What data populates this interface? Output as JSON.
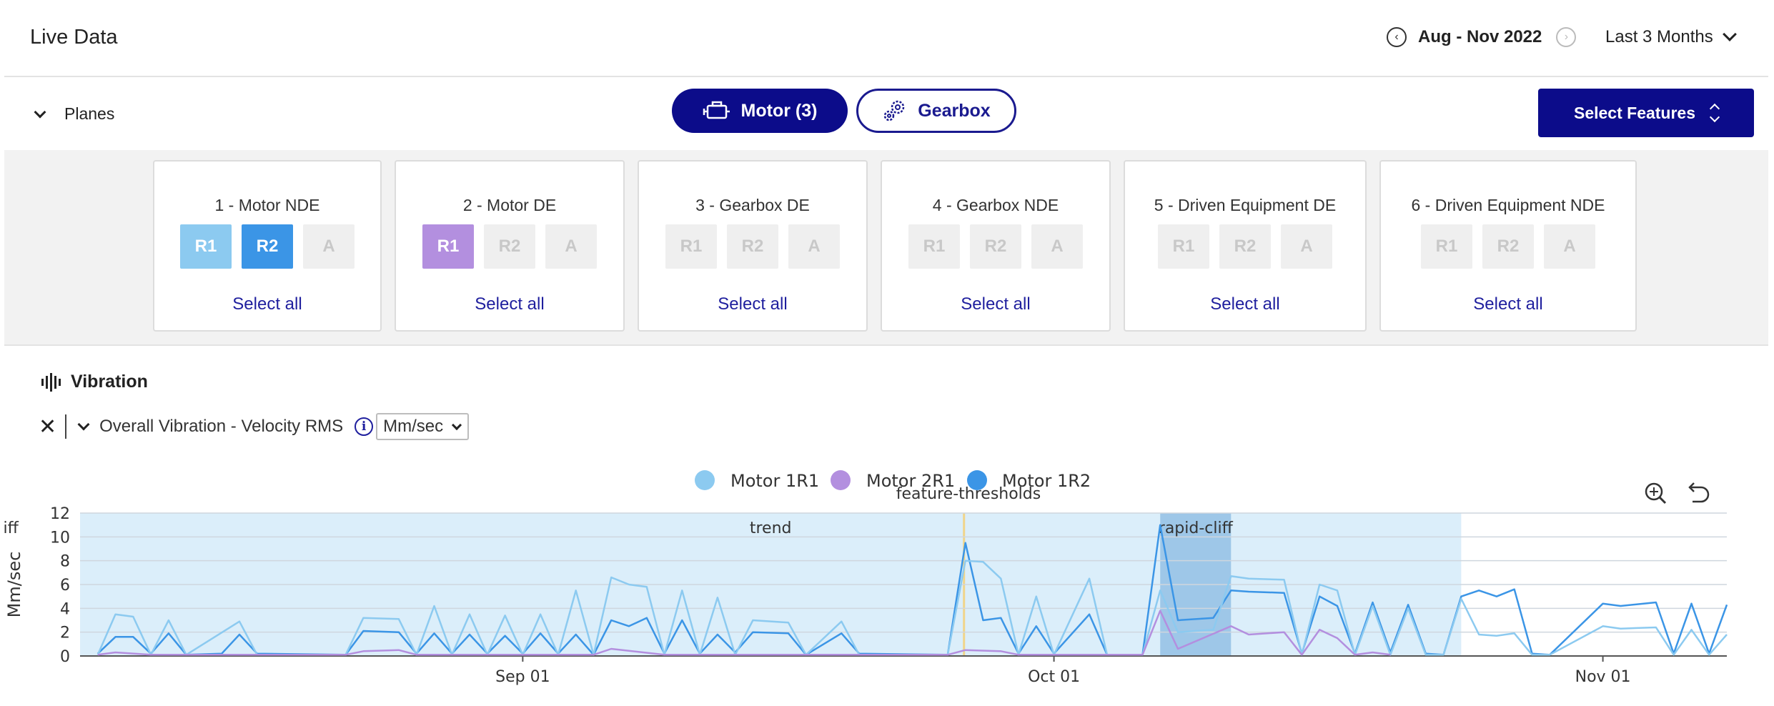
{
  "header": {
    "title": "Live Data",
    "date_range": "Aug - Nov 2022",
    "period": "Last 3 Months",
    "prev_icon": "chevron-left-circle-icon",
    "next_icon": "chevron-right-circle-icon"
  },
  "planes_bar": {
    "toggle_label": "Planes",
    "tabs": [
      {
        "label": "Motor (3)",
        "icon": "motor-icon",
        "active": true
      },
      {
        "label": "Gearbox",
        "icon": "gears-icon",
        "active": false
      }
    ],
    "select_features_label": "Select Features"
  },
  "planes": [
    {
      "name": "1 - Motor NDE",
      "chips": [
        {
          "label": "R1",
          "state": "sel-lightblue"
        },
        {
          "label": "R2",
          "state": "sel-blue"
        },
        {
          "label": "A",
          "state": "off"
        }
      ],
      "select_all": "Select all"
    },
    {
      "name": "2 - Motor DE",
      "chips": [
        {
          "label": "R1",
          "state": "sel-purple"
        },
        {
          "label": "R2",
          "state": "off"
        },
        {
          "label": "A",
          "state": "off"
        }
      ],
      "select_all": "Select all"
    },
    {
      "name": "3 - Gearbox DE",
      "chips": [
        {
          "label": "R1",
          "state": "off"
        },
        {
          "label": "R2",
          "state": "off"
        },
        {
          "label": "A",
          "state": "off"
        }
      ],
      "select_all": "Select all"
    },
    {
      "name": "4 - Gearbox NDE",
      "chips": [
        {
          "label": "R1",
          "state": "off"
        },
        {
          "label": "R2",
          "state": "off"
        },
        {
          "label": "A",
          "state": "off"
        }
      ],
      "select_all": "Select all"
    },
    {
      "name": "5 - Driven Equipment DE",
      "chips": [
        {
          "label": "R1",
          "state": "off"
        },
        {
          "label": "R2",
          "state": "off"
        },
        {
          "label": "A",
          "state": "off"
        }
      ],
      "select_all": "Select all"
    },
    {
      "name": "6 - Driven Equipment NDE",
      "chips": [
        {
          "label": "R1",
          "state": "off"
        },
        {
          "label": "R2",
          "state": "off"
        },
        {
          "label": "A",
          "state": "off"
        }
      ],
      "select_all": "Select all"
    }
  ],
  "vibration": {
    "section_title": "Vibration",
    "metric_label": "Overall Vibration - Velocity RMS",
    "unit": "Mm/sec"
  },
  "chart_data": {
    "type": "line",
    "ylabel": "Mm/sec",
    "ylim": [
      0,
      12
    ],
    "yticks": [
      0,
      2,
      4,
      6,
      8,
      10,
      12
    ],
    "x_range": [
      "2022-08-07",
      "2022-11-08"
    ],
    "xticks": [
      {
        "date": "2022-09-01",
        "label": "Sep 01"
      },
      {
        "date": "2022-10-01",
        "label": "Oct 01"
      },
      {
        "date": "2022-11-01",
        "label": "Nov 01"
      }
    ],
    "grid": true,
    "legend_position": "top-center",
    "legend": [
      {
        "name": "Motor 1R1",
        "color": "#8ccaf0"
      },
      {
        "name": "Motor 2R1",
        "color": "#b38fdf"
      },
      {
        "name": "Motor 1R2",
        "color": "#3b95e6"
      }
    ],
    "threshold_label": "feature-thresholds",
    "highlight_band": {
      "from": "2022-08-07",
      "to": "2022-10-24",
      "color": "#dbeefa"
    },
    "annotations": [
      {
        "label": "cliff",
        "from": "2022-08-37",
        "to": "2022-09-07"
      },
      {
        "label": "trend",
        "at": "2022-09-15"
      },
      {
        "label": "rapid-cliff",
        "from": "2022-10-07",
        "to": "2022-10-11"
      }
    ],
    "series": [
      {
        "name": "Motor 1R2",
        "color": "#3b95e6",
        "points": [
          [
            "2022-08-08",
            0.2
          ],
          [
            "2022-08-09",
            1.6
          ],
          [
            "2022-08-10",
            1.6
          ],
          [
            "2022-08-11",
            0.2
          ],
          [
            "2022-08-12",
            1.9
          ],
          [
            "2022-08-13",
            0.1
          ],
          [
            "2022-08-15",
            0.2
          ],
          [
            "2022-08-16",
            1.8
          ],
          [
            "2022-08-17",
            0.2
          ],
          [
            "2022-08-22",
            0.1
          ],
          [
            "2022-08-23",
            2.1
          ],
          [
            "2022-08-25",
            2.0
          ],
          [
            "2022-08-26",
            0.2
          ],
          [
            "2022-08-27",
            1.9
          ],
          [
            "2022-08-28",
            0.2
          ],
          [
            "2022-08-29",
            1.8
          ],
          [
            "2022-08-30",
            0.2
          ],
          [
            "2022-08-31",
            1.7
          ],
          [
            "2022-09-01",
            0.2
          ],
          [
            "2022-09-02",
            1.9
          ],
          [
            "2022-09-03",
            0.2
          ],
          [
            "2022-09-04",
            1.8
          ],
          [
            "2022-09-05",
            0.1
          ],
          [
            "2022-09-06",
            3.0
          ],
          [
            "2022-09-07",
            2.5
          ],
          [
            "2022-09-08",
            3.2
          ],
          [
            "2022-09-09",
            0.2
          ],
          [
            "2022-09-10",
            3.0
          ],
          [
            "2022-09-11",
            0.2
          ],
          [
            "2022-09-12",
            1.8
          ],
          [
            "2022-09-13",
            0.3
          ],
          [
            "2022-09-14",
            2.0
          ],
          [
            "2022-09-16",
            1.9
          ],
          [
            "2022-09-17",
            0.1
          ],
          [
            "2022-09-19",
            1.9
          ],
          [
            "2022-09-20",
            0.2
          ],
          [
            "2022-09-25",
            0.1
          ],
          [
            "2022-09-26",
            9.5
          ],
          [
            "2022-09-27",
            3.0
          ],
          [
            "2022-09-28",
            3.2
          ],
          [
            "2022-09-29",
            0.2
          ],
          [
            "2022-09-30",
            2.5
          ],
          [
            "2022-10-01",
            0.2
          ],
          [
            "2022-10-03",
            3.5
          ],
          [
            "2022-10-04",
            0.1
          ],
          [
            "2022-10-06",
            0.1
          ],
          [
            "2022-10-07",
            11.0
          ],
          [
            "2022-10-08",
            3.0
          ],
          [
            "2022-10-10",
            3.2
          ],
          [
            "2022-10-11",
            5.5
          ],
          [
            "2022-10-12",
            5.4
          ],
          [
            "2022-10-14",
            5.3
          ],
          [
            "2022-10-15",
            0.2
          ],
          [
            "2022-10-16",
            5.0
          ],
          [
            "2022-10-17",
            4.2
          ],
          [
            "2022-10-18",
            0.2
          ],
          [
            "2022-10-19",
            4.5
          ],
          [
            "2022-10-20",
            0.3
          ],
          [
            "2022-10-21",
            4.3
          ],
          [
            "2022-10-22",
            0.2
          ],
          [
            "2022-10-23",
            0.1
          ],
          [
            "2022-10-24",
            5.0
          ],
          [
            "2022-10-25",
            5.5
          ],
          [
            "2022-10-26",
            5.0
          ],
          [
            "2022-10-27",
            5.6
          ],
          [
            "2022-10-28",
            0.2
          ],
          [
            "2022-10-29",
            0.1
          ],
          [
            "2022-11-01",
            4.4
          ],
          [
            "2022-11-02",
            4.2
          ],
          [
            "2022-11-04",
            4.5
          ],
          [
            "2022-11-05",
            0.2
          ],
          [
            "2022-11-06",
            4.4
          ],
          [
            "2022-11-07",
            0.2
          ],
          [
            "2022-11-08",
            4.3
          ]
        ]
      },
      {
        "name": "Motor 1R1",
        "color": "#8ccaf0",
        "points": [
          [
            "2022-08-08",
            0.1
          ],
          [
            "2022-08-09",
            3.5
          ],
          [
            "2022-08-10",
            3.3
          ],
          [
            "2022-08-11",
            0.1
          ],
          [
            "2022-08-12",
            3.0
          ],
          [
            "2022-08-13",
            0.1
          ],
          [
            "2022-08-16",
            2.9
          ],
          [
            "2022-08-17",
            0.1
          ],
          [
            "2022-08-22",
            0.1
          ],
          [
            "2022-08-23",
            3.2
          ],
          [
            "2022-08-25",
            3.1
          ],
          [
            "2022-08-26",
            0.1
          ],
          [
            "2022-08-27",
            4.2
          ],
          [
            "2022-08-28",
            0.1
          ],
          [
            "2022-08-29",
            3.5
          ],
          [
            "2022-08-30",
            0.1
          ],
          [
            "2022-08-31",
            3.4
          ],
          [
            "2022-09-01",
            0.1
          ],
          [
            "2022-09-02",
            3.5
          ],
          [
            "2022-09-03",
            0.1
          ],
          [
            "2022-09-04",
            5.5
          ],
          [
            "2022-09-05",
            0.1
          ],
          [
            "2022-09-06",
            6.6
          ],
          [
            "2022-09-07",
            6.0
          ],
          [
            "2022-09-08",
            5.8
          ],
          [
            "2022-09-09",
            0.1
          ],
          [
            "2022-09-10",
            5.5
          ],
          [
            "2022-09-11",
            0.1
          ],
          [
            "2022-09-12",
            4.9
          ],
          [
            "2022-09-13",
            0.1
          ],
          [
            "2022-09-14",
            3.0
          ],
          [
            "2022-09-16",
            2.8
          ],
          [
            "2022-09-17",
            0.1
          ],
          [
            "2022-09-19",
            2.9
          ],
          [
            "2022-09-20",
            0.1
          ],
          [
            "2022-09-25",
            0.1
          ],
          [
            "2022-09-26",
            8.0
          ],
          [
            "2022-09-27",
            7.9
          ],
          [
            "2022-09-28",
            6.5
          ],
          [
            "2022-09-29",
            0.1
          ],
          [
            "2022-09-30",
            5.0
          ],
          [
            "2022-10-01",
            0.1
          ],
          [
            "2022-10-03",
            6.5
          ],
          [
            "2022-10-04",
            0.1
          ],
          [
            "2022-10-06",
            0.1
          ],
          [
            "2022-10-07",
            5.5
          ],
          [
            "2022-10-08",
            2.0
          ],
          [
            "2022-10-10",
            2.2
          ],
          [
            "2022-10-11",
            6.7
          ],
          [
            "2022-10-12",
            6.5
          ],
          [
            "2022-10-14",
            6.4
          ],
          [
            "2022-10-15",
            0.1
          ],
          [
            "2022-10-16",
            6.0
          ],
          [
            "2022-10-17",
            5.5
          ],
          [
            "2022-10-18",
            0.1
          ],
          [
            "2022-10-19",
            4.2
          ],
          [
            "2022-10-20",
            0.1
          ],
          [
            "2022-10-21",
            4.0
          ],
          [
            "2022-10-22",
            0.1
          ],
          [
            "2022-10-23",
            0.1
          ],
          [
            "2022-10-24",
            4.8
          ],
          [
            "2022-10-25",
            1.8
          ],
          [
            "2022-10-26",
            1.7
          ],
          [
            "2022-10-27",
            1.9
          ],
          [
            "2022-10-28",
            0.1
          ],
          [
            "2022-10-29",
            0.1
          ],
          [
            "2022-11-01",
            2.5
          ],
          [
            "2022-11-02",
            2.3
          ],
          [
            "2022-11-04",
            2.4
          ],
          [
            "2022-11-05",
            0.1
          ],
          [
            "2022-11-06",
            2.2
          ],
          [
            "2022-11-07",
            0.1
          ],
          [
            "2022-11-08",
            1.8
          ]
        ]
      },
      {
        "name": "Motor 2R1",
        "color": "#b38fdf",
        "points": [
          [
            "2022-08-08",
            0.1
          ],
          [
            "2022-08-09",
            0.3
          ],
          [
            "2022-08-11",
            0.1
          ],
          [
            "2022-08-22",
            0.1
          ],
          [
            "2022-08-23",
            0.4
          ],
          [
            "2022-08-25",
            0.5
          ],
          [
            "2022-08-26",
            0.1
          ],
          [
            "2022-09-05",
            0.1
          ],
          [
            "2022-09-06",
            0.6
          ],
          [
            "2022-09-09",
            0.1
          ],
          [
            "2022-09-25",
            0.1
          ],
          [
            "2022-09-26",
            0.5
          ],
          [
            "2022-09-28",
            0.4
          ],
          [
            "2022-09-29",
            0.1
          ],
          [
            "2022-10-06",
            0.1
          ],
          [
            "2022-10-07",
            3.8
          ],
          [
            "2022-10-08",
            0.6
          ],
          [
            "2022-10-11",
            2.5
          ],
          [
            "2022-10-12",
            1.8
          ],
          [
            "2022-10-14",
            2.0
          ],
          [
            "2022-10-15",
            0.1
          ],
          [
            "2022-10-16",
            2.2
          ],
          [
            "2022-10-17",
            1.5
          ],
          [
            "2022-10-18",
            0.1
          ],
          [
            "2022-10-19",
            0.3
          ],
          [
            "2022-10-20",
            0.1
          ]
        ]
      }
    ]
  }
}
